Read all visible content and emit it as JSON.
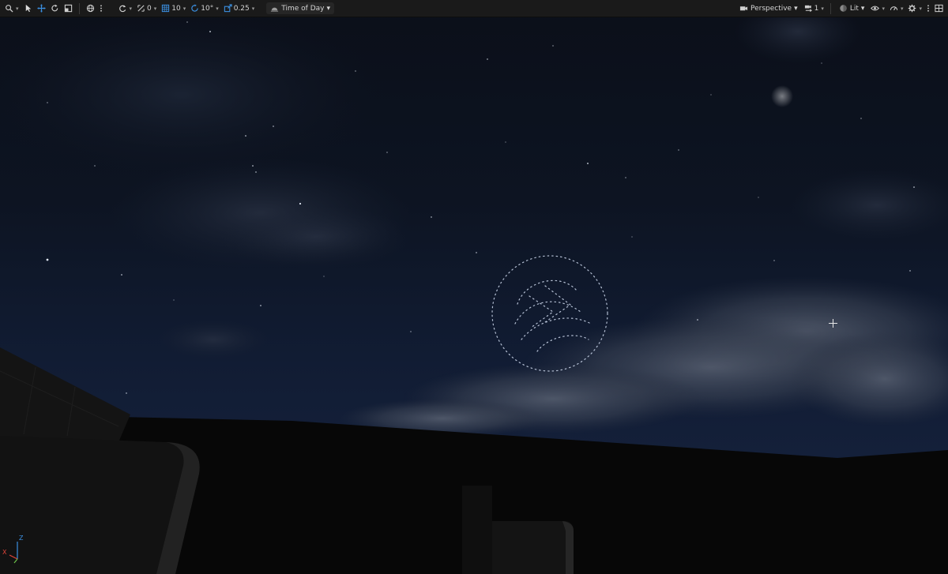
{
  "toolbar": {
    "snap_translate_value": "0",
    "grid_size_value": "10",
    "rotate_snap_value": "10°",
    "scale_snap_value": "0.25",
    "time_of_day_label": "Time of Day",
    "viewport_mode_label": "Perspective",
    "camera_speed_value": "1",
    "view_mode_label": "Lit"
  },
  "gizmo": {
    "z_label": "Z",
    "x_label": "X"
  },
  "colors": {
    "toolbar_bg": "#1a1a1a",
    "accent_blue": "#3b8fe0",
    "axis_x": "#e0453a",
    "axis_y": "#6cc24a",
    "axis_z": "#3b8fe0"
  },
  "icons": [
    "select-mode-icon",
    "cursor-icon",
    "translate-icon",
    "rotate-icon",
    "scale-icon",
    "world-local-icon",
    "more-options-icon",
    "surface-snap-icon",
    "translate-snap-icon",
    "grid-snap-icon",
    "rotation-snap-icon",
    "scale-snap-icon",
    "time-of-day-icon",
    "camera-icon",
    "camera-speed-icon",
    "lit-sphere-icon",
    "show-eye-icon",
    "realtime-icon",
    "settings-gear-icon",
    "kebab-icon",
    "layout-icon"
  ]
}
